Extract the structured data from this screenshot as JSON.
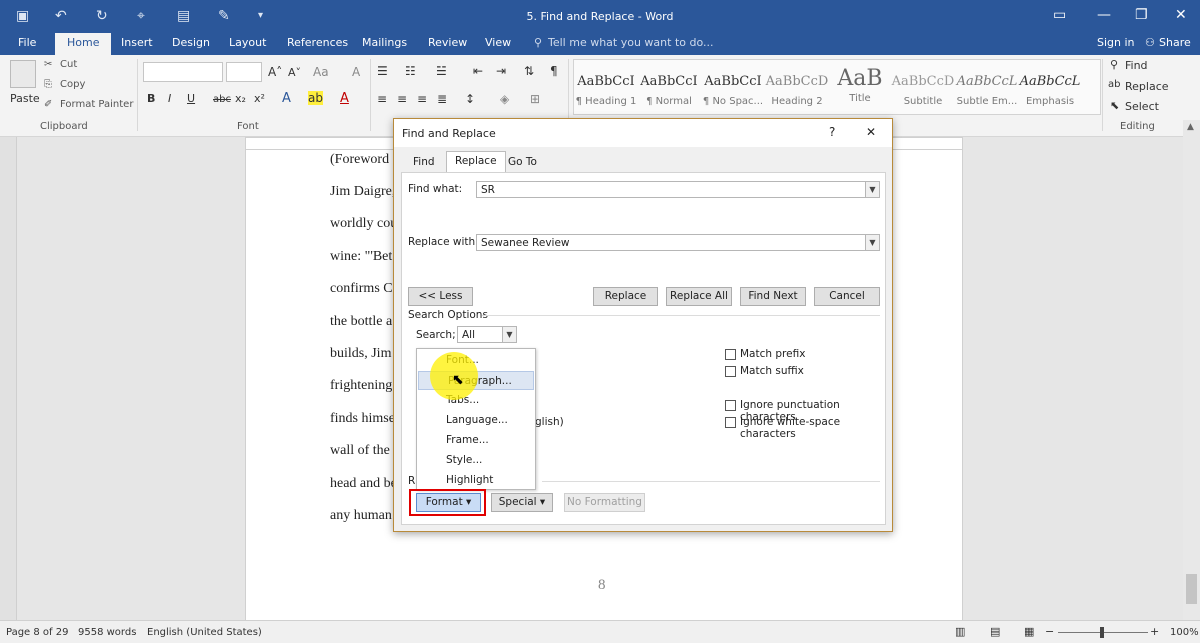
{
  "window": {
    "title": "5. Find and Replace - Word"
  },
  "tabs": [
    {
      "label": "File"
    },
    {
      "label": "Home"
    },
    {
      "label": "Insert"
    },
    {
      "label": "Design"
    },
    {
      "label": "Layout"
    },
    {
      "label": "References"
    },
    {
      "label": "Mailings"
    },
    {
      "label": "Review"
    },
    {
      "label": "View"
    }
  ],
  "tell_me": "Tell me what you want to do...",
  "account": {
    "sign_in": "Sign in",
    "share": "Share"
  },
  "clipboard": {
    "paste": "Paste",
    "cut": "Cut",
    "copy": "Copy",
    "format_painter": "Format Painter",
    "label": "Clipboard"
  },
  "font_group": {
    "label": "Font"
  },
  "styles": [
    {
      "sample": "AaBbCcI",
      "name": "¶ Heading 1"
    },
    {
      "sample": "AaBbCcI",
      "name": "¶ Normal"
    },
    {
      "sample": "AaBbCcI",
      "name": "¶ No Spac..."
    },
    {
      "sample": "AaBbCcD",
      "name": "Heading 2"
    },
    {
      "sample": "AaB",
      "name": "Title"
    },
    {
      "sample": "AaBbCcD",
      "name": "Subtitle"
    },
    {
      "sample": "AaBbCcL",
      "name": "Subtle Em..."
    },
    {
      "sample": "AaBbCcL",
      "name": "Emphasis"
    }
  ],
  "editing": {
    "find": "Find",
    "replace": "Replace",
    "select": "Select",
    "label": "Editing"
  },
  "document": {
    "lines": [
      "(Foreword",
      "Jim Daigre,",
      "worldly cou",
      "wine: \"'Bet",
      "confirms Co",
      "the bottle a",
      "builds, Jim",
      "frightening",
      "finds himse",
      "wall of the",
      "head and be",
      "any human"
    ],
    "page_number": "8"
  },
  "dialog": {
    "title": "Find and Replace",
    "help": "?",
    "close": "✕",
    "tabs": [
      {
        "label": "Find"
      },
      {
        "label": "Replace"
      },
      {
        "label": "Go To"
      }
    ],
    "find_label": "Find what:",
    "find_value": "SR",
    "replace_label": "Replace with:",
    "replace_value": "Sewanee Review",
    "buttons": {
      "less": "<< Less",
      "replace": "Replace",
      "replace_all": "Replace All",
      "find_next": "Find Next",
      "cancel": "Cancel"
    },
    "search_options": "Search Options",
    "search_label": "Search;",
    "search_value": "All",
    "options_right": [
      {
        "label": "Match prefix"
      },
      {
        "label": "Match suffix"
      },
      {
        "label": "Ignore punctuation characters"
      },
      {
        "label": "Ignore white-space characters"
      }
    ],
    "partial_english": "glish)",
    "replace_section_partial": "R",
    "format_button": "Format ▾",
    "special_button": "Special ▾",
    "no_formatting_button": "No Formatting"
  },
  "format_menu": {
    "items": [
      {
        "label": "Font..."
      },
      {
        "label": "Paragraph..."
      },
      {
        "label": "Tabs..."
      },
      {
        "label": "Language..."
      },
      {
        "label": "Frame..."
      },
      {
        "label": "Style..."
      },
      {
        "label": "Highlight"
      }
    ]
  },
  "status": {
    "page": "Page 8 of 29",
    "words": "9558 words",
    "language": "English (United States)",
    "zoom": "100%"
  },
  "colors": {
    "brand": "#2b579a",
    "highlight_ring": "#e00000",
    "cursor_highlight": "#fff000"
  }
}
